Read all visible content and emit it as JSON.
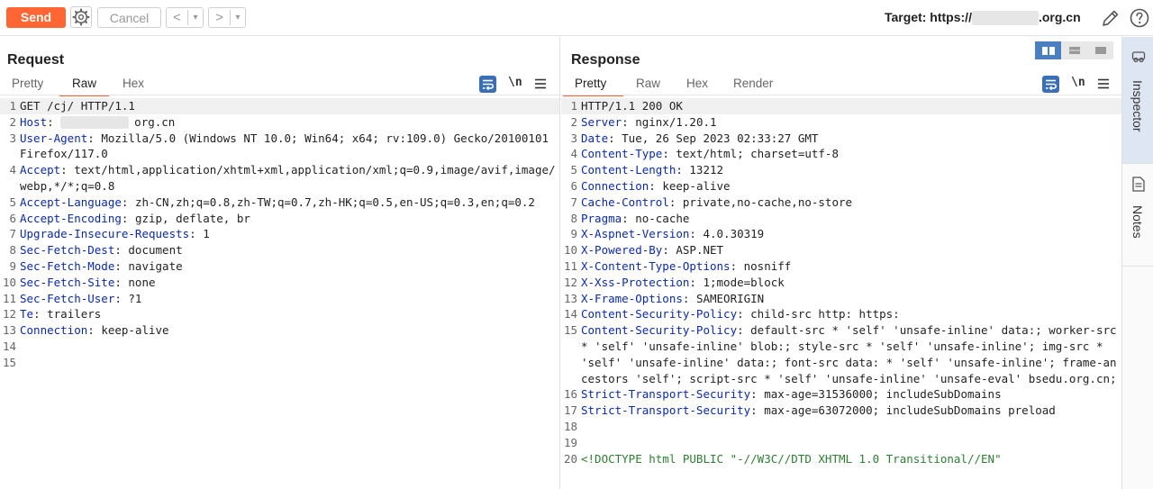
{
  "toolbar": {
    "send_label": "Send",
    "cancel_label": "Cancel",
    "back_label": "<",
    "back_drop": "▾",
    "forward_label": ">",
    "forward_drop": "▾",
    "target_prefix": "Target: https://",
    "target_suffix": ".org.cn"
  },
  "request": {
    "title": "Request",
    "tabs": [
      "Pretty",
      "Raw",
      "Hex"
    ],
    "active_tab": "Raw",
    "newline_label": "\\n",
    "lines": [
      {
        "n": "1",
        "name": "",
        "rest": "GET /cj/ HTTP/1.1"
      },
      {
        "n": "2",
        "name": "Host",
        "rest": ": ",
        "blur": true,
        "tail": "org.cn"
      },
      {
        "n": "3",
        "name": "User-Agent",
        "rest": ": Mozilla/5.0 (Windows NT 10.0; Win64; x64; rv:109.0) Gecko/20100101 Firefox/117.0"
      },
      {
        "n": "4",
        "name": "Accept",
        "rest": ": text/html,application/xhtml+xml,application/xml;q=0.9,image/avif,image/webp,*/*;q=0.8"
      },
      {
        "n": "5",
        "name": "Accept-Language",
        "rest": ": zh-CN,zh;q=0.8,zh-TW;q=0.7,zh-HK;q=0.5,en-US;q=0.3,en;q=0.2"
      },
      {
        "n": "6",
        "name": "Accept-Encoding",
        "rest": ": gzip, deflate, br"
      },
      {
        "n": "7",
        "name": "Upgrade-Insecure-Requests",
        "rest": ": 1"
      },
      {
        "n": "8",
        "name": "Sec-Fetch-Dest",
        "rest": ": document"
      },
      {
        "n": "9",
        "name": "Sec-Fetch-Mode",
        "rest": ": navigate"
      },
      {
        "n": "10",
        "name": "Sec-Fetch-Site",
        "rest": ": none"
      },
      {
        "n": "11",
        "name": "Sec-Fetch-User",
        "rest": ": ?1"
      },
      {
        "n": "12",
        "name": "Te",
        "rest": ": trailers"
      },
      {
        "n": "13",
        "name": "Connection",
        "rest": ": keep-alive"
      },
      {
        "n": "14",
        "name": "",
        "rest": ""
      },
      {
        "n": "15",
        "name": "",
        "rest": ""
      }
    ]
  },
  "response": {
    "title": "Response",
    "tabs": [
      "Pretty",
      "Raw",
      "Hex",
      "Render"
    ],
    "active_tab": "Pretty",
    "newline_label": "\\n",
    "lines": [
      {
        "n": "1",
        "name": "",
        "rest": "HTTP/1.1 200 OK"
      },
      {
        "n": "2",
        "name": "Server",
        "rest": ": nginx/1.20.1"
      },
      {
        "n": "3",
        "name": "Date",
        "rest": ": Tue, 26 Sep 2023 02:33:27 GMT"
      },
      {
        "n": "4",
        "name": "Content-Type",
        "rest": ": text/html; charset=utf-8"
      },
      {
        "n": "5",
        "name": "Content-Length",
        "rest": ": 13212"
      },
      {
        "n": "6",
        "name": "Connection",
        "rest": ": keep-alive"
      },
      {
        "n": "7",
        "name": "Cache-Control",
        "rest": ": private,no-cache,no-store"
      },
      {
        "n": "8",
        "name": "Pragma",
        "rest": ": no-cache"
      },
      {
        "n": "9",
        "name": "X-Aspnet-Version",
        "rest": ": 4.0.30319"
      },
      {
        "n": "10",
        "name": "X-Powered-By",
        "rest": ": ASP.NET"
      },
      {
        "n": "11",
        "name": "X-Content-Type-Options",
        "rest": ": nosniff"
      },
      {
        "n": "12",
        "name": "X-Xss-Protection",
        "rest": ": 1;mode=block"
      },
      {
        "n": "13",
        "name": "X-Frame-Options",
        "rest": ": SAMEORIGIN"
      },
      {
        "n": "14",
        "name": "Content-Security-Policy",
        "rest": ": child-src http: https:"
      },
      {
        "n": "15",
        "name": "Content-Security-Policy",
        "rest": ": default-src * 'self' 'unsafe-inline' data:; worker-src * 'self' 'unsafe-inline' blob:; style-src * 'self' 'unsafe-inline'; img-src * 'self' 'unsafe-inline' data:; font-src data: * 'self' 'unsafe-inline'; frame-ancestors 'self'; script-src * 'self' 'unsafe-inline' 'unsafe-eval' bsedu.org.cn;"
      },
      {
        "n": "16",
        "name": "Strict-Transport-Security",
        "rest": ": max-age=31536000; includeSubDomains"
      },
      {
        "n": "17",
        "name": "Strict-Transport-Security",
        "rest": ": max-age=63072000; includeSubDomains preload"
      },
      {
        "n": "18",
        "name": "",
        "rest": ""
      },
      {
        "n": "19",
        "name": "",
        "rest": ""
      },
      {
        "n": "20",
        "name": "",
        "rest": "<!DOCTYPE html PUBLIC \"-//W3C//DTD XHTML 1.0 Transitional//EN\"",
        "doctype": true
      }
    ]
  },
  "sidebar": {
    "tabs": [
      "Inspector",
      "Notes"
    ]
  },
  "colors": {
    "accent": "#ff6633",
    "header_name": "#0b2aa8",
    "doctype": "#2e7d32",
    "layout_active": "#4a7fc1"
  },
  "icons": [
    "gear-icon",
    "pencil-icon",
    "help-icon",
    "wrap-icon",
    "menu-icon",
    "inspector-icon",
    "notes-icon",
    "layout-columns-icon",
    "layout-rows-icon",
    "layout-single-icon"
  ]
}
